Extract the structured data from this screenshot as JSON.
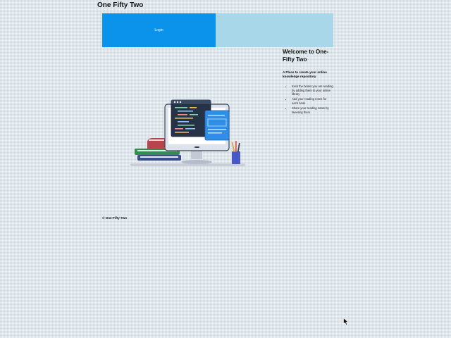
{
  "app": {
    "brand": "One Fifty Two"
  },
  "tabs": {
    "login_label": "Login"
  },
  "welcome": {
    "title": "Welcome to One-Fifty Two",
    "subtitle": "A Place to create your online knowledge repository",
    "features": [
      "track the books you are reading by adding them to your online library",
      "Add your reading notes for each book",
      "Share your reading notes by tweeting them"
    ]
  },
  "footer": {
    "copyright": "© One-Fifty-Two"
  },
  "colors": {
    "login_tab": "#0b93ec",
    "secondary_tab": "#a8d7ea",
    "page_background": "#eef3f6"
  },
  "icons": {
    "hero": "desktop-books-illustration",
    "pointer": "mouse-cursor-icon"
  }
}
